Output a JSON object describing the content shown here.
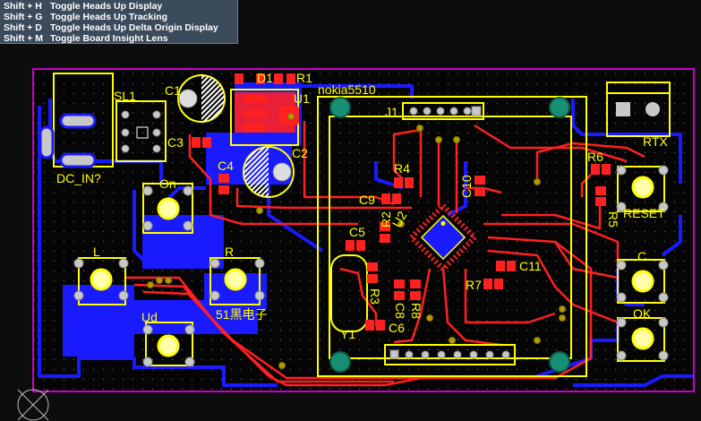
{
  "hud": {
    "rows": [
      {
        "key": "Shift + H",
        "action": "Toggle Heads Up Display"
      },
      {
        "key": "Shift + G",
        "action": "Toggle Heads Up Tracking"
      },
      {
        "key": "Shift + D",
        "action": "Toggle Heads Up Delta Origin Display"
      },
      {
        "key": "Shift + M",
        "action": "Toggle Board Insight Lens"
      }
    ]
  },
  "board": {
    "designators": {
      "SL1": "SL1",
      "C1": "C1",
      "D1": "D1",
      "R1": "R1",
      "U1": "U1",
      "C3": "C3",
      "C2": "C2",
      "C4": "C4",
      "DC_IN": "DC_IN?",
      "LCD": "nokia5510",
      "J1": "J1",
      "RTX": "RTX",
      "R4": "R4",
      "C10": "C10",
      "C9": "C9",
      "R2": "R2",
      "U2": "U2",
      "C5": "C5",
      "R6": "R6",
      "R5": "R5",
      "C11": "C11",
      "R7": "R7",
      "R3": "R3",
      "C8": "C8",
      "R8": "R8",
      "C6": "C6",
      "Y1": "Y1",
      "BTN_ON": "On",
      "BTN_L": "L",
      "BTN_R": "R",
      "BTN_UD": "Ud",
      "BTN_RESET": "RESET",
      "BTN_C": "C",
      "BTN_OK": "OK",
      "BRAND": "51黑电子"
    }
  },
  "colors": {
    "background": "#0d0d0d",
    "board_outline": "#c800c8",
    "top_copper": "#ff2020",
    "bottom_copper": "#1a1aff",
    "silkscreen": "#ffff00",
    "pad": "#c8c8c8",
    "via": "#b39b00",
    "mounting_hole": "#178f74",
    "hud_background": "#3c4b5c"
  }
}
